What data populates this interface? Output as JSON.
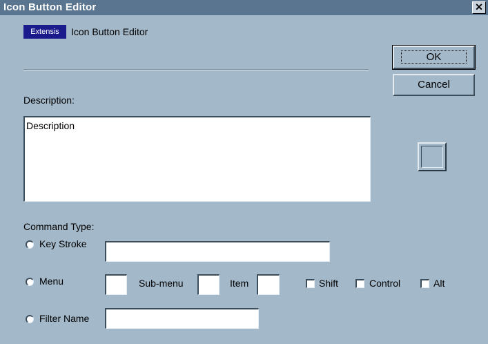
{
  "window": {
    "title": "Icon Button Editor",
    "close_glyph": "✕"
  },
  "header": {
    "logo_text_main": "Extensis",
    "dialog_title": "Icon Button Editor"
  },
  "buttons": {
    "ok": "OK",
    "cancel": "Cancel"
  },
  "description": {
    "label": "Description:",
    "value": "Description"
  },
  "command_type": {
    "label": "Command Type:",
    "key_stroke_label": "Key Stroke",
    "key_stroke_value": "",
    "menu_label": "Menu",
    "submenu_label": "Sub-menu",
    "item_label": "Item",
    "shift_label": "Shift",
    "control_label": "Control",
    "alt_label": "Alt",
    "filter_name_label": "Filter Name",
    "filter_name_value": ""
  },
  "colors": {
    "background": "#a3b8c9",
    "titlebar": "#5a7590",
    "logo_bg": "#1a1a8c"
  }
}
